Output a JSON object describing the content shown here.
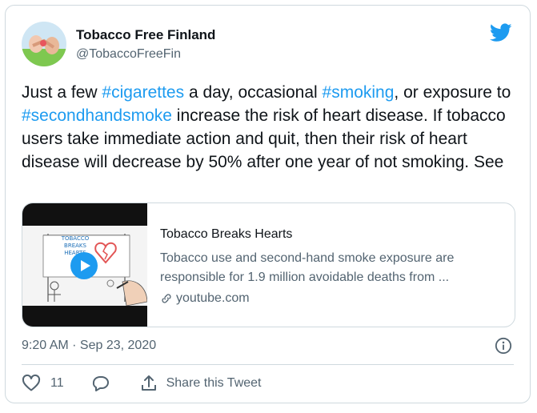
{
  "author": {
    "name": "Tobacco Free Finland",
    "handle": "@TobaccoFreeFin"
  },
  "tweet": {
    "segments": [
      {
        "text": "Just a few ",
        "hashtag": false
      },
      {
        "text": "#cigarettes",
        "hashtag": true
      },
      {
        "text": " a day, occasional ",
        "hashtag": false
      },
      {
        "text": "#smoking",
        "hashtag": true
      },
      {
        "text": ", or exposure to ",
        "hashtag": false
      },
      {
        "text": "#secondhandsmoke",
        "hashtag": true
      },
      {
        "text": " increase the risk of heart disease. If tobacco users take immediate action and quit, then their risk of heart disease will decrease by 50% after one year of not smoking. See",
        "hashtag": false
      }
    ]
  },
  "link_card": {
    "thumbnail_text_line1": "TOBACCO",
    "thumbnail_text_line2": "BREAKS HEARTS",
    "title": "Tobacco Breaks Hearts",
    "description_line1": "Tobacco use and second-hand smoke exposure are",
    "description_line2": "responsible for 1.9 million avoidable deaths from ...",
    "domain": "youtube.com"
  },
  "meta": {
    "timestamp": "9:20 AM · Sep 23, 2020"
  },
  "actions": {
    "like_count": "11",
    "share_label": "Share this Tweet"
  },
  "colors": {
    "accent": "#1d9bf0",
    "text": "#0f1419",
    "secondary": "#536471",
    "like_red": "#e0245e"
  },
  "icons": {
    "brand": "twitter-bird-icon",
    "info": "info-icon",
    "link": "link-icon",
    "like": "heart-icon",
    "reply": "reply-bubble-icon",
    "share": "share-icon",
    "play": "play-icon"
  }
}
